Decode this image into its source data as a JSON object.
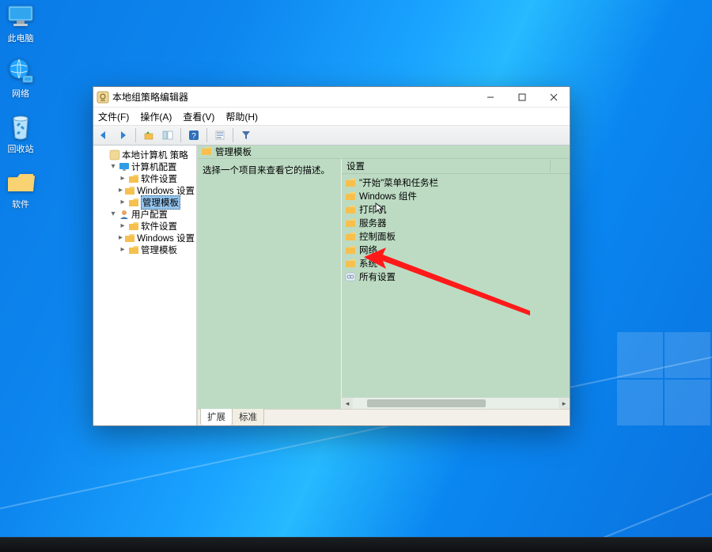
{
  "desktop": {
    "icons": [
      {
        "name": "this-pc",
        "label": "此电脑"
      },
      {
        "name": "network",
        "label": "网络"
      },
      {
        "name": "recycle-bin",
        "label": "回收站"
      },
      {
        "name": "software-folder",
        "label": "软件"
      }
    ]
  },
  "window": {
    "title": "本地组策略编辑器",
    "menus": {
      "file": "文件(F)",
      "action": "操作(A)",
      "view": "查看(V)",
      "help": "帮助(H)"
    },
    "tree": {
      "root": "本地计算机 策略",
      "computer": "计算机配置",
      "user": "用户配置",
      "software_settings": "软件设置",
      "windows_settings": "Windows 设置",
      "admin_templates": "管理模板"
    },
    "content_header": "管理模板",
    "description_prompt": "选择一个项目来查看它的描述。",
    "column_header": "设置",
    "items": [
      {
        "label": "\"开始\"菜单和任务栏",
        "kind": "folder"
      },
      {
        "label": "Windows 组件",
        "kind": "folder"
      },
      {
        "label": "打印机",
        "kind": "folder"
      },
      {
        "label": "服务器",
        "kind": "folder"
      },
      {
        "label": "控制面板",
        "kind": "folder"
      },
      {
        "label": "网络",
        "kind": "folder"
      },
      {
        "label": "系统",
        "kind": "folder"
      },
      {
        "label": "所有设置",
        "kind": "settings"
      }
    ],
    "tabs": {
      "extended": "扩展",
      "standard": "标准"
    }
  }
}
